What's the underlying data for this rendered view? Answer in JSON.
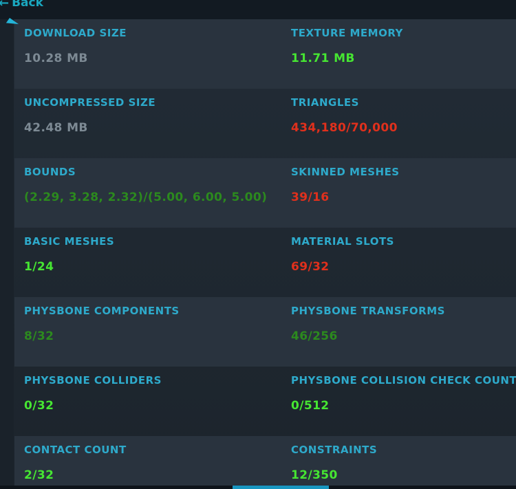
{
  "nav": {
    "back_label": "Back"
  },
  "colors": {
    "label": "#2eaacb",
    "gray": "#7d8a94",
    "bright_green": "#46e632",
    "dark_green": "#2c8a1e",
    "red": "#e0301c"
  },
  "stats": [
    {
      "label": "DOWNLOAD SIZE",
      "value": "10.28 MB",
      "status": "gray"
    },
    {
      "label": "TEXTURE MEMORY",
      "value": "11.71 MB",
      "status": "bright_green"
    },
    {
      "label": "UNCOMPRESSED SIZE",
      "value": "42.48 MB",
      "status": "gray"
    },
    {
      "label": "TRIANGLES",
      "value": "434,180/70,000",
      "status": "red"
    },
    {
      "label": "BOUNDS",
      "value": "(2.29, 3.28, 2.32)/(5.00, 6.00, 5.00)",
      "status": "dark_green"
    },
    {
      "label": "SKINNED MESHES",
      "value": "39/16",
      "status": "red"
    },
    {
      "label": "BASIC MESHES",
      "value": "1/24",
      "status": "bright_green"
    },
    {
      "label": "MATERIAL SLOTS",
      "value": "69/32",
      "status": "red"
    },
    {
      "label": "PHYSBONE COMPONENTS",
      "value": "8/32",
      "status": "dark_green"
    },
    {
      "label": "PHYSBONE TRANSFORMS",
      "value": "46/256",
      "status": "dark_green"
    },
    {
      "label": "PHYSBONE COLLIDERS",
      "value": "0/32",
      "status": "bright_green"
    },
    {
      "label": "PHYSBONE COLLISION CHECK COUNT",
      "value": "0/512",
      "status": "bright_green"
    },
    {
      "label": "CONTACT COUNT",
      "value": "2/32",
      "status": "bright_green"
    },
    {
      "label": "CONSTRAINTS",
      "value": "12/350",
      "status": "bright_green"
    }
  ]
}
